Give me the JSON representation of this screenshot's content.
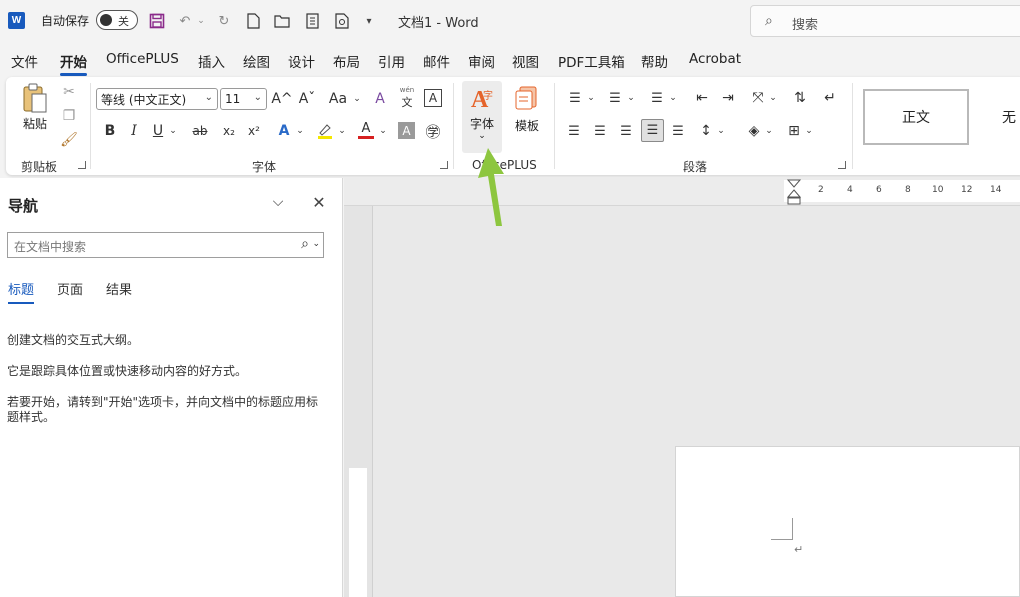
{
  "titlebar": {
    "autosave_label": "自动保存",
    "autosave_state": "关",
    "doc_title": "文档1  -  Word",
    "search_placeholder": "搜索"
  },
  "menu": {
    "tabs": [
      "文件",
      "开始",
      "OfficePLUS",
      "插入",
      "绘图",
      "设计",
      "布局",
      "引用",
      "邮件",
      "审阅",
      "视图",
      "PDF工具箱",
      "帮助",
      "Acrobat"
    ],
    "active": "开始"
  },
  "ribbon": {
    "clipboard": {
      "paste_label": "粘贴",
      "group_label": "剪贴板"
    },
    "font": {
      "font_name": "等线 (中文正文)",
      "font_size": "11",
      "group_label": "字体",
      "bold": "B",
      "italic": "I",
      "underline": "U",
      "strike": "ab",
      "subscript": "x₂",
      "superscript": "x²",
      "grow": "A^",
      "shrink": "Aˇ",
      "case": "Aa",
      "pinyin_top": "wén",
      "pinyin_bottom": "文"
    },
    "officeplus": {
      "font_btn": "字体",
      "template_btn": "模板",
      "group_label": "OfficePLUS"
    },
    "paragraph": {
      "group_label": "段落"
    },
    "styles": {
      "normal": "正文",
      "no_spacing": "无"
    }
  },
  "nav": {
    "title": "导航",
    "search_placeholder": "在文档中搜索",
    "tabs": [
      "标题",
      "页面",
      "结果"
    ],
    "active_tab": "标题",
    "line1": "创建文档的交互式大纲。",
    "line2": "它是跟踪具体位置或快速移动内容的好方式。",
    "line3": "若要开始，请转到\"开始\"选项卡，并向文档中的标题应用标题样式。"
  },
  "ruler": {
    "ticks": [
      "2",
      "4",
      "6",
      "8",
      "10",
      "12",
      "14"
    ]
  },
  "colors": {
    "accent": "#185abd",
    "arrow": "#8dc63f"
  }
}
